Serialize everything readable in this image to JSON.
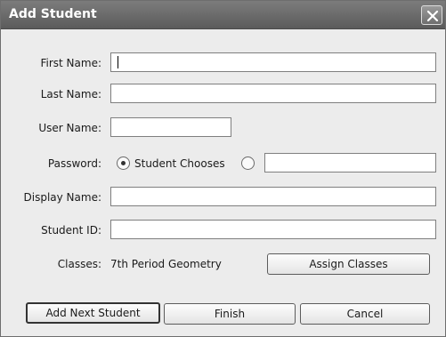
{
  "dialog": {
    "title": "Add Student"
  },
  "form": {
    "first_name": {
      "label": "First Name:",
      "value": ""
    },
    "last_name": {
      "label": "Last Name:",
      "value": ""
    },
    "user_name": {
      "label": "User Name:",
      "value": ""
    },
    "password": {
      "label": "Password:",
      "option_student_chooses": "Student Chooses",
      "selected": "student_chooses",
      "custom_value": ""
    },
    "display_name": {
      "label": "Display Name:",
      "value": ""
    },
    "student_id": {
      "label": "Student ID:",
      "value": ""
    },
    "classes": {
      "label": "Classes:",
      "value": "7th Period Geometry"
    }
  },
  "buttons": {
    "assign_classes": "Assign Classes",
    "add_next": "Add Next Student",
    "finish": "Finish",
    "cancel": "Cancel"
  },
  "icons": {
    "close": "close-icon",
    "radio_selected": "radio-selected",
    "radio_unselected": "radio-unselected"
  }
}
